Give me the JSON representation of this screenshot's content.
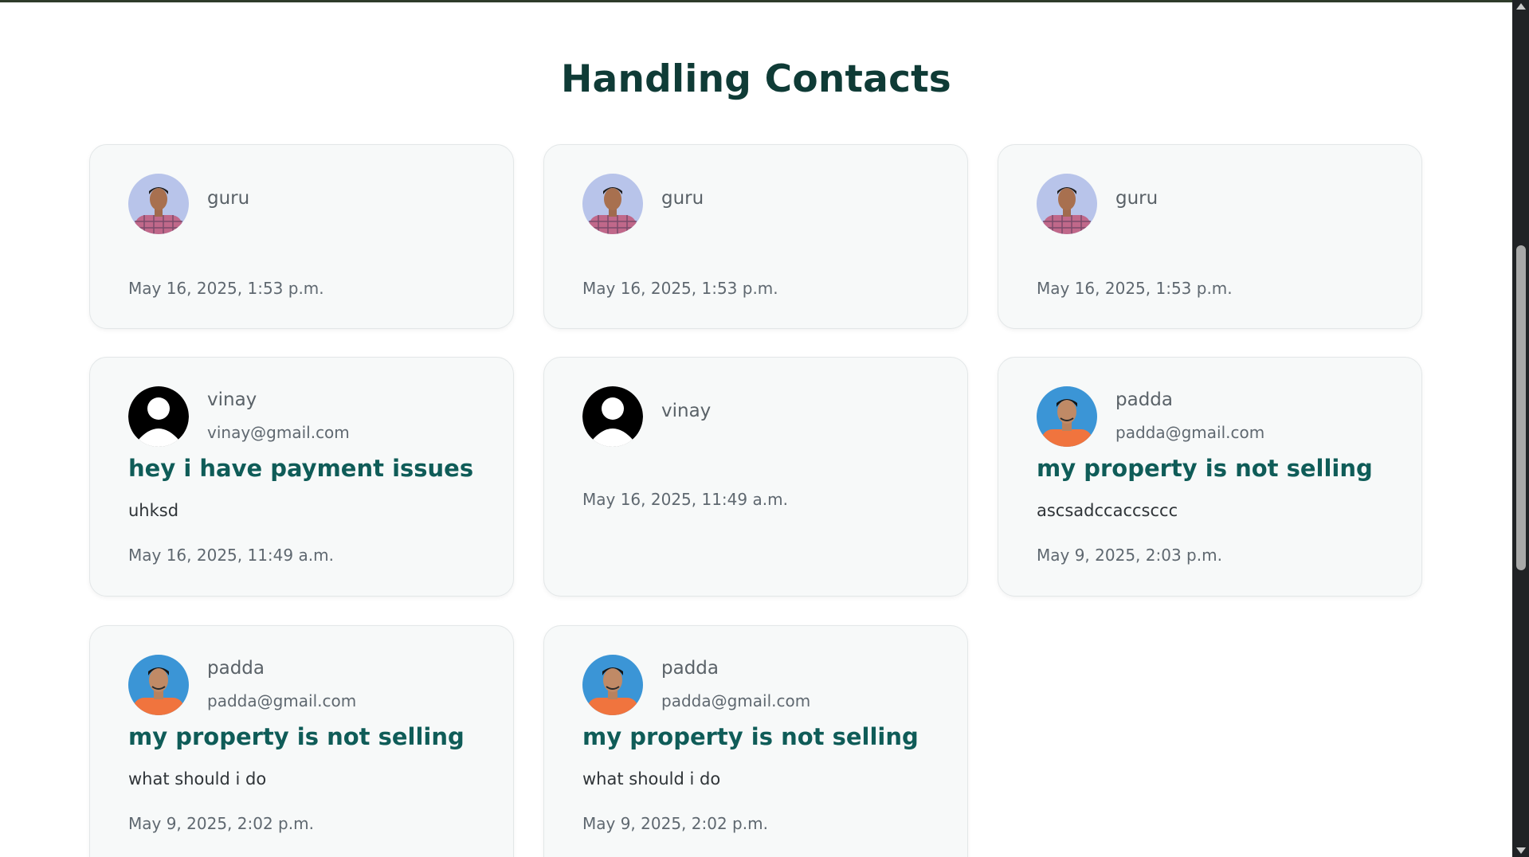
{
  "page": {
    "title": "Handling Contacts"
  },
  "cards": [
    {
      "name": "guru",
      "email": "",
      "subject": "",
      "message": "",
      "date": "May 16, 2025, 1:53 p.m.",
      "avatar": "avatar-photo-guru-icon"
    },
    {
      "name": "guru",
      "email": "",
      "subject": "",
      "message": "",
      "date": "May 16, 2025, 1:53 p.m.",
      "avatar": "avatar-photo-guru-icon"
    },
    {
      "name": "guru",
      "email": "",
      "subject": "",
      "message": "",
      "date": "May 16, 2025, 1:53 p.m.",
      "avatar": "avatar-photo-guru-icon"
    },
    {
      "name": "vinay",
      "email": "vinay@gmail.com",
      "subject": "hey i have payment issues",
      "message": "uhksd",
      "date": "May 16, 2025, 11:49 a.m.",
      "avatar": "default-user-icon"
    },
    {
      "name": "vinay",
      "email": "",
      "subject": "",
      "message": "",
      "date": "May 16, 2025, 11:49 a.m.",
      "avatar": "default-user-icon"
    },
    {
      "name": "padda",
      "email": "padda@gmail.com",
      "subject": "my property is not selling",
      "message": "ascsadccaccsccc",
      "date": "May 9, 2025, 2:03 p.m.",
      "avatar": "avatar-photo-padda-icon"
    },
    {
      "name": "padda",
      "email": "padda@gmail.com",
      "subject": "my property is not selling",
      "message": "what should i do",
      "date": "May 9, 2025, 2:02 p.m.",
      "avatar": "avatar-photo-padda-icon"
    },
    {
      "name": "padda",
      "email": "padda@gmail.com",
      "subject": "my property is not selling",
      "message": "what should i do",
      "date": "May 9, 2025, 2:02 p.m.",
      "avatar": "avatar-photo-padda-icon"
    }
  ],
  "colors": {
    "title": "#0f3b36",
    "subject": "#0f5c58",
    "card_bg": "#f7f9f9",
    "card_border": "#e3e7e8"
  }
}
